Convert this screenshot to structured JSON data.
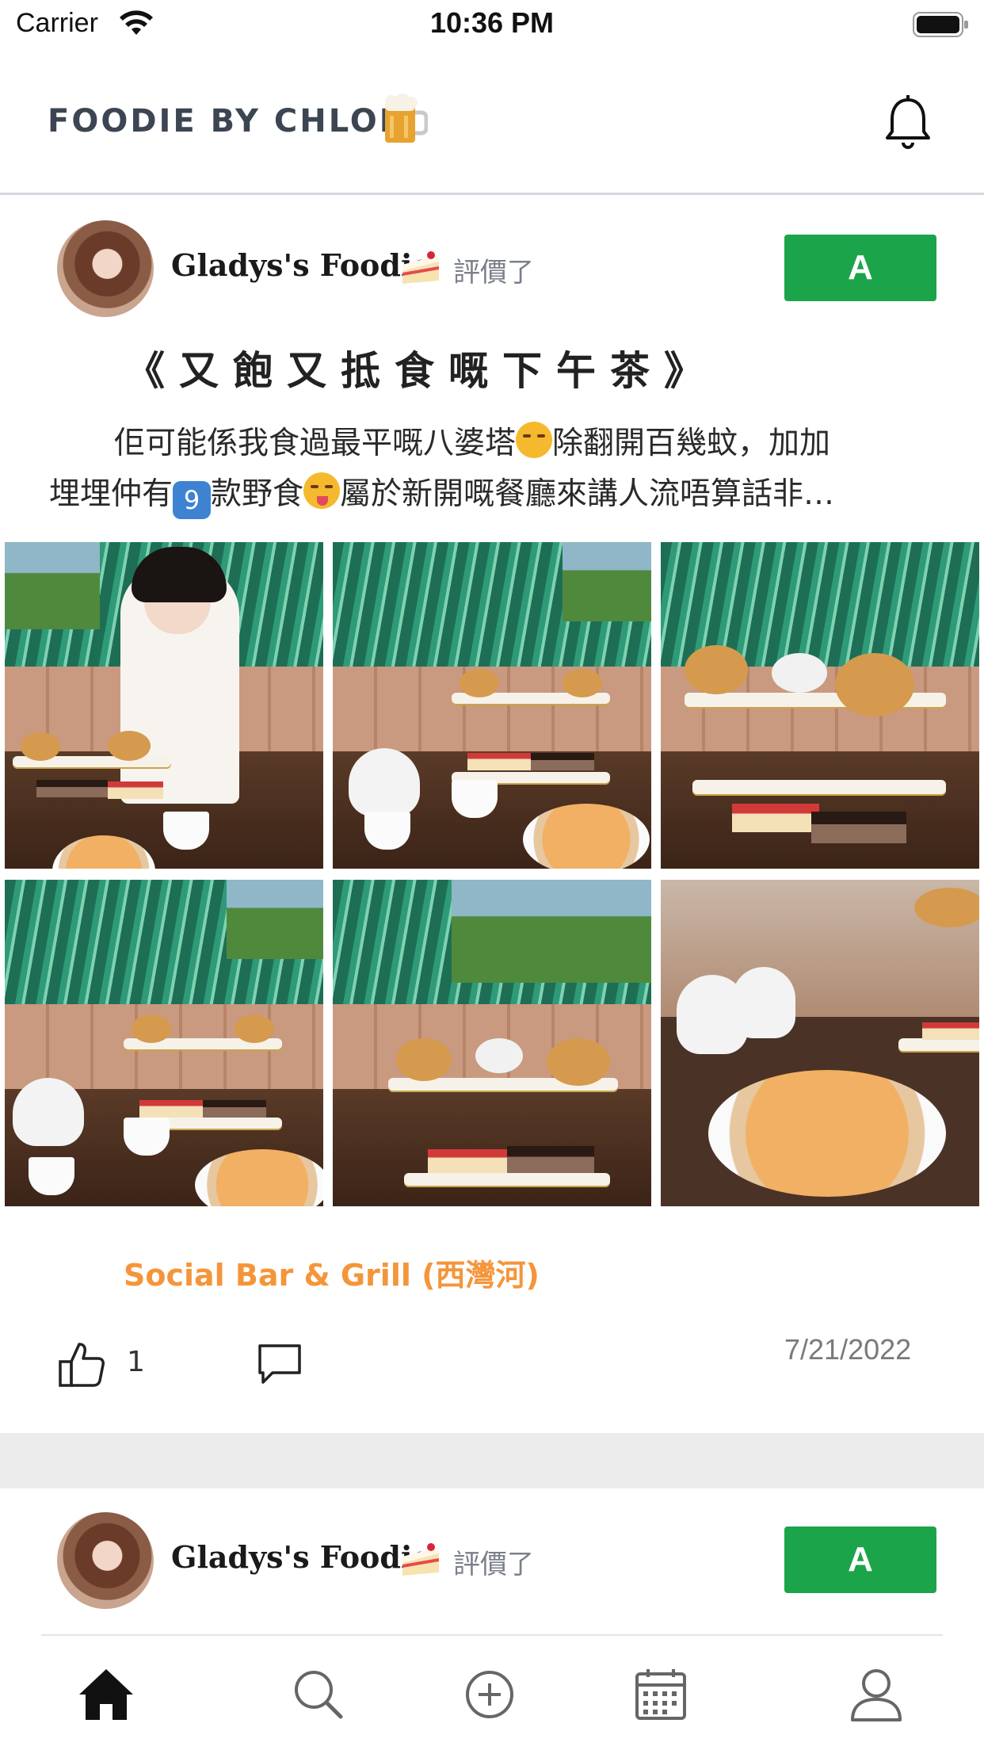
{
  "status_bar": {
    "carrier": "Carrier",
    "time": "10:36 PM"
  },
  "header": {
    "brand": "FOODIE BY CHLOE",
    "brand_icon": "beer-mug-icon",
    "notification_icon": "bell-icon"
  },
  "posts": [
    {
      "author": "Gladys's Foodie",
      "author_icon": "cake-icon",
      "action": "評價了",
      "rating": "A",
      "title": "《又飽又抵食嘅下午茶》",
      "body_line1_a": "佢可能係我食過最平嘅八婆塔",
      "body_line1_b": "除翻開百幾蚊，加加",
      "body_line2_a": "埋埋仲有",
      "body_line2_badge": "9",
      "body_line2_b": "款野食",
      "body_line2_c": "屬於新開嘅餐廳來講人流唔算話非…",
      "photos": [
        "photo-1",
        "photo-2",
        "photo-3",
        "photo-4",
        "photo-5",
        "photo-6"
      ],
      "restaurant": "Social Bar & Grill (西灣河)",
      "likes": "1",
      "date": "7/21/2022"
    },
    {
      "author": "Gladys's Foodie",
      "author_icon": "cake-icon",
      "action": "評價了",
      "rating": "A"
    }
  ],
  "tab_bar": {
    "tabs": [
      "home-icon",
      "search-icon",
      "add-circle-icon",
      "calendar-icon",
      "profile-icon"
    ],
    "active": "home-icon"
  },
  "colors": {
    "rating_green": "#1ca44a",
    "restaurant_orange": "#f5953a",
    "brand_gray": "#3c4652"
  }
}
